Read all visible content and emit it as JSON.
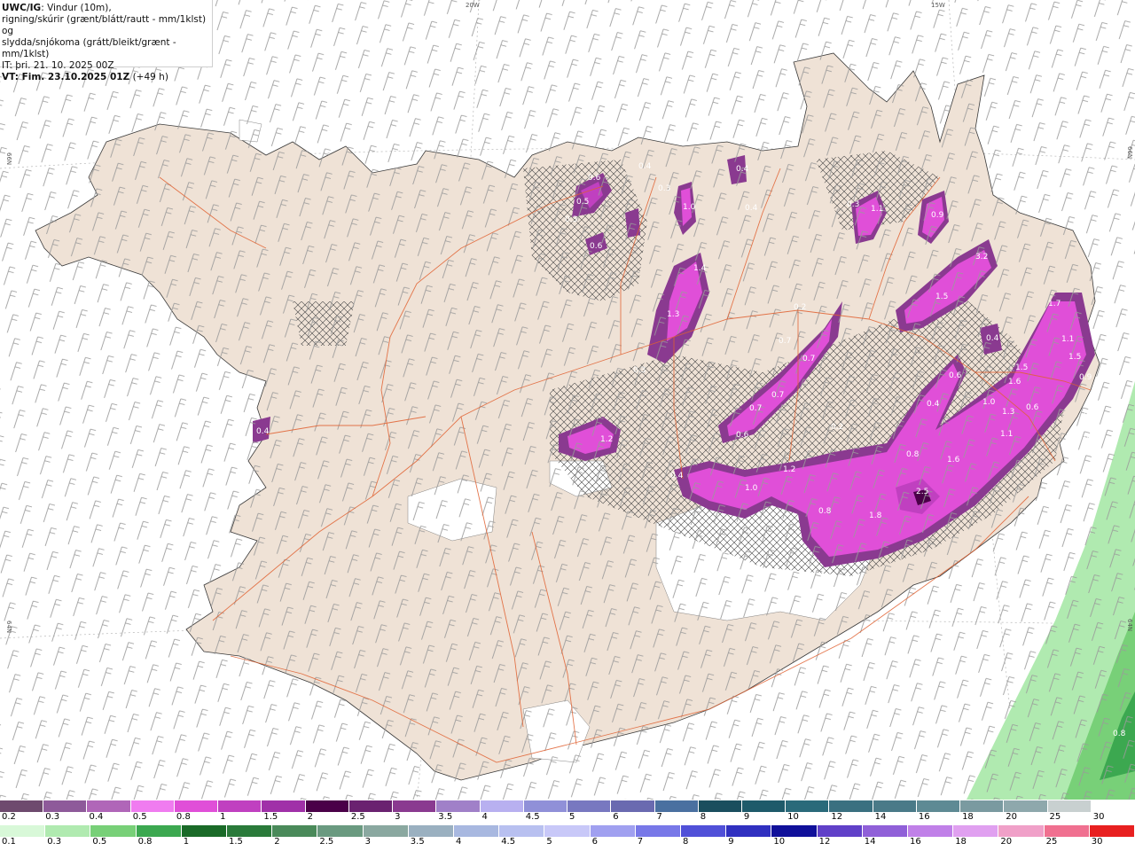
{
  "header": {
    "product": "UWC/IG",
    "line1_rest": ": Vindur (10m),",
    "line2": "rigning/skúrir (grænt/blátt/rautt - mm/1klst) og",
    "line3": "slydda/snjókoma (grátt/bleikt/grænt - mm/1klst)",
    "it_label": "IT:",
    "it_value": "þri. 21. 10. 2025 00Z",
    "vt_label": "VT: Fim. 23.10.2025 01Z",
    "vt_offset": "(+49 h)"
  },
  "graticule": {
    "top_labels": [
      "20W",
      "15W"
    ],
    "right_labels": [
      "66N",
      "64N"
    ],
    "left_labels": [
      "66N",
      "64N"
    ]
  },
  "map_values": [
    {
      "text": "0.6"
    },
    {
      "text": "0.5"
    },
    {
      "text": "0.4"
    },
    {
      "text": "0.3"
    },
    {
      "text": "0.3"
    },
    {
      "text": "1.0"
    },
    {
      "text": "0.4"
    },
    {
      "text": "0.6"
    },
    {
      "text": "0.4"
    },
    {
      "text": "1.4"
    },
    {
      "text": "1.3"
    },
    {
      "text": "0.3"
    },
    {
      "text": "0.3"
    },
    {
      "text": "1.1"
    },
    {
      "text": "0.9"
    },
    {
      "text": "3.2"
    },
    {
      "text": "1.5"
    },
    {
      "text": "1.7"
    },
    {
      "text": "0.4"
    },
    {
      "text": "1.1"
    },
    {
      "text": "1.5"
    },
    {
      "text": "1.5"
    },
    {
      "text": "1.6"
    },
    {
      "text": "1.0"
    },
    {
      "text": "1.3"
    },
    {
      "text": "0.6"
    },
    {
      "text": "1.1"
    },
    {
      "text": "0.6"
    },
    {
      "text": "0.4"
    },
    {
      "text": "0.2"
    },
    {
      "text": "0.7"
    },
    {
      "text": "0.7"
    },
    {
      "text": "0.7"
    },
    {
      "text": "0.7"
    },
    {
      "text": "0.6"
    },
    {
      "text": "0.2"
    },
    {
      "text": "0.8"
    },
    {
      "text": "1.6"
    },
    {
      "text": "2.5"
    },
    {
      "text": "1.8"
    },
    {
      "text": "0.8"
    },
    {
      "text": "1.0"
    },
    {
      "text": "1.2"
    },
    {
      "text": "0.4"
    },
    {
      "text": "1.2"
    },
    {
      "text": "0.4"
    },
    {
      "text": "0.9"
    },
    {
      "text": "0.5"
    },
    {
      "text": "0.8"
    },
    {
      "text": "0.8"
    }
  ],
  "legend_snow": {
    "labels": [
      "0.2",
      "0.3",
      "0.4",
      "0.5",
      "0.8",
      "1",
      "1.5",
      "2",
      "2.5",
      "3",
      "3.5",
      "4",
      "4.5",
      "5",
      "6",
      "7",
      "8",
      "9",
      "10",
      "12",
      "14",
      "16",
      "18",
      "20",
      "25",
      "30"
    ],
    "colors": [
      "#6e4a6e",
      "#8e5a9a",
      "#b066b8",
      "#f07cf0",
      "#e04fd8",
      "#c040c0",
      "#a030a8",
      "#4a0048",
      "#6a2270",
      "#8a3a90",
      "#a080c8",
      "#b8b0f0",
      "#9090d8",
      "#7878c0",
      "#6a6ab0",
      "#4a70a0",
      "#1a4e5e",
      "#1e5a6a",
      "#2a6a7a",
      "#3a7080",
      "#4a7a88",
      "#5e8a94",
      "#7a9aa0",
      "#8ea8ac",
      "#c8d0d0",
      "#ffffff"
    ]
  },
  "legend_rain": {
    "labels": [
      "0.1",
      "0.3",
      "0.5",
      "0.8",
      "1",
      "1.5",
      "2",
      "2.5",
      "3",
      "3.5",
      "4",
      "4.5",
      "5",
      "6",
      "7",
      "8",
      "9",
      "10",
      "12",
      "14",
      "16",
      "18",
      "20",
      "25",
      "30"
    ],
    "colors": [
      "#d8f8d8",
      "#b0eab0",
      "#78d078",
      "#3ca850",
      "#1a6a28",
      "#2a7a3a",
      "#4a8a5a",
      "#6a9a80",
      "#8aa8a0",
      "#9ab0c0",
      "#a8b8e0",
      "#b8c0f0",
      "#c8c8f8",
      "#a0a0f0",
      "#7878e8",
      "#5050d8",
      "#3030c0",
      "#10109a",
      "#6040c8",
      "#9060d8",
      "#c080e8",
      "#e0a0f0",
      "#f0a0c8",
      "#f07090",
      "#e82020"
    ]
  }
}
